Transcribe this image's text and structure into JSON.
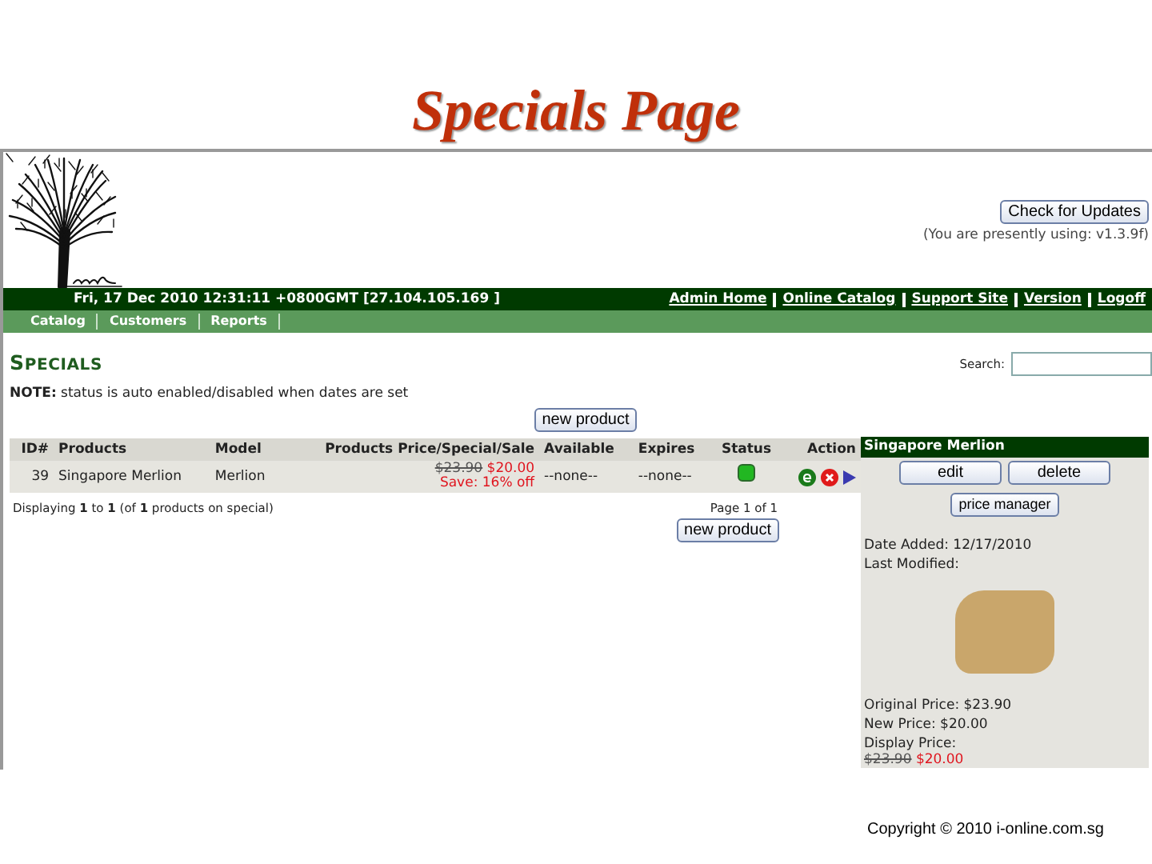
{
  "slide_title": "Specials Page",
  "header": {
    "update_button": "Check for Updates",
    "version_note": "(You are presently using: v1.3.9f)"
  },
  "top_bar": {
    "datetime": "Fri, 17 Dec 2010 12:31:11 +0800GMT [27.104.105.169 ]",
    "links": [
      "Admin Home",
      "Online Catalog",
      "Support Site",
      "Version",
      "Logoff"
    ]
  },
  "menu": [
    "Catalog",
    "Customers",
    "Reports"
  ],
  "page_heading": "SPECIALS",
  "note": "**NOTE:** status is auto enabled/disabled when dates are set",
  "search": {
    "label": "Search:"
  },
  "new_product_top": "new product",
  "table": {
    "columns": [
      "ID#",
      "Products",
      "Model",
      "Products Price/Special/Sale",
      "Available",
      "Expires",
      "Status",
      "Action"
    ],
    "rows": [
      {
        "id": "39",
        "product": "Singapore Merlion",
        "model": "Merlion",
        "original_price": "$23.90",
        "special_price": "$20.00",
        "save": "Save: 16% off",
        "available": "--none--",
        "expires": "--none--",
        "status_on": true,
        "selected": true
      }
    ]
  },
  "displaying": "Displaying **1** to **1** (of **1** products on special)",
  "page_info": "Page 1 of 1",
  "new_product_bottom": "new product",
  "side_panel": {
    "title": "Singapore Merlion",
    "buttons": [
      "edit",
      "delete"
    ],
    "price_manager": "price manager",
    "date_added": "Date Added: 12/17/2010",
    "last_modified": "Last Modified:",
    "original_price": "Original Price: $23.90",
    "new_price": "New Price: $20.00",
    "display_price_label": "Display Price:",
    "display_old": "$23.90",
    "display_new": "$20.00"
  },
  "copyright": "Copyright © 2010  i-online.com.sg"
}
